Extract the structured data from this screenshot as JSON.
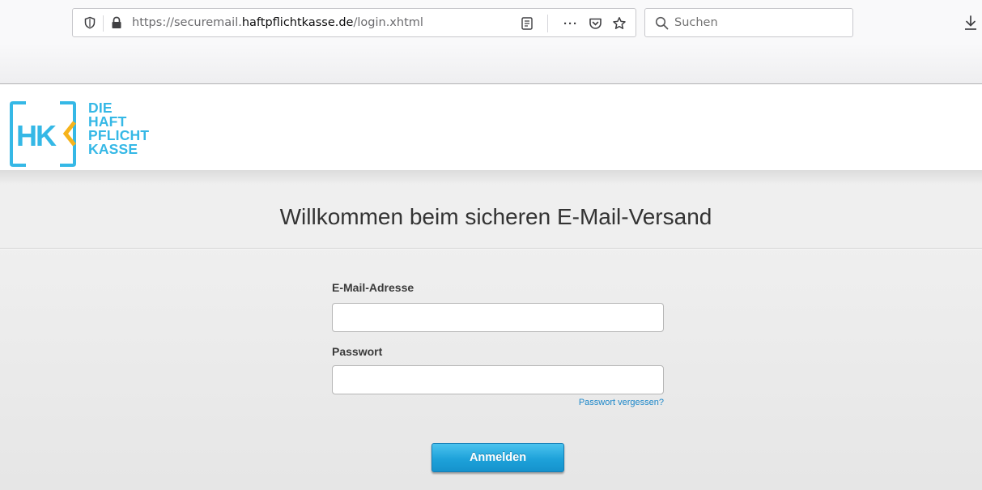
{
  "browser": {
    "url_prefix": "https://securemail.",
    "url_domain": "haftpflichtkasse.de",
    "url_path": "/login.xhtml",
    "search_placeholder": "Suchen",
    "more_label": "···",
    "icons": [
      "shield-icon",
      "lock-icon",
      "reader-view-icon",
      "more-actions-icon",
      "pocket-icon",
      "bookmark-star-icon",
      "search-icon",
      "download-icon"
    ]
  },
  "header": {
    "logo_mark": "HK",
    "logo_lines": [
      "DIE",
      "HAFT",
      "PFLICHT",
      "KASSE"
    ],
    "brand_color": "#35b8e6",
    "accent_color": "#f6b31b"
  },
  "login": {
    "title": "Willkommen beim sicheren E-Mail-Versand",
    "email_label": "E-Mail-Adresse",
    "email_value": "",
    "password_label": "Passwort",
    "password_value": "",
    "forgot_link": "Passwort vergessen?",
    "submit_label": "Anmelden",
    "button_color": "#1ea2da"
  }
}
